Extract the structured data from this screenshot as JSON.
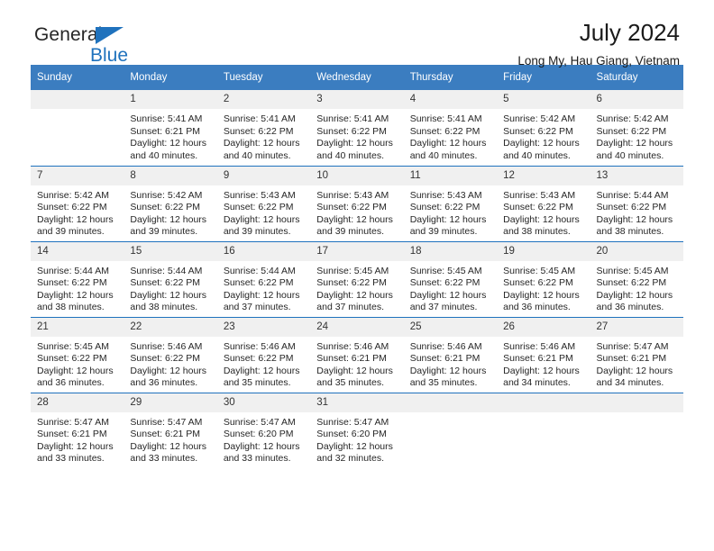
{
  "brand": {
    "name_part1": "General",
    "name_part2": "Blue",
    "flag_icon": "triangle-flag-icon"
  },
  "header": {
    "title": "July 2024",
    "subtitle": "Long My, Hau Giang, Vietnam"
  },
  "colors": {
    "header_blue": "#3b7dc0",
    "rule_blue": "#1f72bd",
    "daynum_band": "#f0f0f0",
    "brand_blue": "#1f72bd",
    "text": "#262626"
  },
  "weekday_headers": [
    "Sunday",
    "Monday",
    "Tuesday",
    "Wednesday",
    "Thursday",
    "Friday",
    "Saturday"
  ],
  "weeks": [
    {
      "days": [
        {
          "num": "",
          "blank": true,
          "lines": []
        },
        {
          "num": "1",
          "blank": false,
          "lines": [
            "Sunrise: 5:41 AM",
            "Sunset: 6:21 PM",
            "Daylight: 12 hours",
            "and 40 minutes."
          ]
        },
        {
          "num": "2",
          "blank": false,
          "lines": [
            "Sunrise: 5:41 AM",
            "Sunset: 6:22 PM",
            "Daylight: 12 hours",
            "and 40 minutes."
          ]
        },
        {
          "num": "3",
          "blank": false,
          "lines": [
            "Sunrise: 5:41 AM",
            "Sunset: 6:22 PM",
            "Daylight: 12 hours",
            "and 40 minutes."
          ]
        },
        {
          "num": "4",
          "blank": false,
          "lines": [
            "Sunrise: 5:41 AM",
            "Sunset: 6:22 PM",
            "Daylight: 12 hours",
            "and 40 minutes."
          ]
        },
        {
          "num": "5",
          "blank": false,
          "lines": [
            "Sunrise: 5:42 AM",
            "Sunset: 6:22 PM",
            "Daylight: 12 hours",
            "and 40 minutes."
          ]
        },
        {
          "num": "6",
          "blank": false,
          "lines": [
            "Sunrise: 5:42 AM",
            "Sunset: 6:22 PM",
            "Daylight: 12 hours",
            "and 40 minutes."
          ]
        }
      ]
    },
    {
      "days": [
        {
          "num": "7",
          "blank": false,
          "lines": [
            "Sunrise: 5:42 AM",
            "Sunset: 6:22 PM",
            "Daylight: 12 hours",
            "and 39 minutes."
          ]
        },
        {
          "num": "8",
          "blank": false,
          "lines": [
            "Sunrise: 5:42 AM",
            "Sunset: 6:22 PM",
            "Daylight: 12 hours",
            "and 39 minutes."
          ]
        },
        {
          "num": "9",
          "blank": false,
          "lines": [
            "Sunrise: 5:43 AM",
            "Sunset: 6:22 PM",
            "Daylight: 12 hours",
            "and 39 minutes."
          ]
        },
        {
          "num": "10",
          "blank": false,
          "lines": [
            "Sunrise: 5:43 AM",
            "Sunset: 6:22 PM",
            "Daylight: 12 hours",
            "and 39 minutes."
          ]
        },
        {
          "num": "11",
          "blank": false,
          "lines": [
            "Sunrise: 5:43 AM",
            "Sunset: 6:22 PM",
            "Daylight: 12 hours",
            "and 39 minutes."
          ]
        },
        {
          "num": "12",
          "blank": false,
          "lines": [
            "Sunrise: 5:43 AM",
            "Sunset: 6:22 PM",
            "Daylight: 12 hours",
            "and 38 minutes."
          ]
        },
        {
          "num": "13",
          "blank": false,
          "lines": [
            "Sunrise: 5:44 AM",
            "Sunset: 6:22 PM",
            "Daylight: 12 hours",
            "and 38 minutes."
          ]
        }
      ]
    },
    {
      "days": [
        {
          "num": "14",
          "blank": false,
          "lines": [
            "Sunrise: 5:44 AM",
            "Sunset: 6:22 PM",
            "Daylight: 12 hours",
            "and 38 minutes."
          ]
        },
        {
          "num": "15",
          "blank": false,
          "lines": [
            "Sunrise: 5:44 AM",
            "Sunset: 6:22 PM",
            "Daylight: 12 hours",
            "and 38 minutes."
          ]
        },
        {
          "num": "16",
          "blank": false,
          "lines": [
            "Sunrise: 5:44 AM",
            "Sunset: 6:22 PM",
            "Daylight: 12 hours",
            "and 37 minutes."
          ]
        },
        {
          "num": "17",
          "blank": false,
          "lines": [
            "Sunrise: 5:45 AM",
            "Sunset: 6:22 PM",
            "Daylight: 12 hours",
            "and 37 minutes."
          ]
        },
        {
          "num": "18",
          "blank": false,
          "lines": [
            "Sunrise: 5:45 AM",
            "Sunset: 6:22 PM",
            "Daylight: 12 hours",
            "and 37 minutes."
          ]
        },
        {
          "num": "19",
          "blank": false,
          "lines": [
            "Sunrise: 5:45 AM",
            "Sunset: 6:22 PM",
            "Daylight: 12 hours",
            "and 36 minutes."
          ]
        },
        {
          "num": "20",
          "blank": false,
          "lines": [
            "Sunrise: 5:45 AM",
            "Sunset: 6:22 PM",
            "Daylight: 12 hours",
            "and 36 minutes."
          ]
        }
      ]
    },
    {
      "days": [
        {
          "num": "21",
          "blank": false,
          "lines": [
            "Sunrise: 5:45 AM",
            "Sunset: 6:22 PM",
            "Daylight: 12 hours",
            "and 36 minutes."
          ]
        },
        {
          "num": "22",
          "blank": false,
          "lines": [
            "Sunrise: 5:46 AM",
            "Sunset: 6:22 PM",
            "Daylight: 12 hours",
            "and 36 minutes."
          ]
        },
        {
          "num": "23",
          "blank": false,
          "lines": [
            "Sunrise: 5:46 AM",
            "Sunset: 6:22 PM",
            "Daylight: 12 hours",
            "and 35 minutes."
          ]
        },
        {
          "num": "24",
          "blank": false,
          "lines": [
            "Sunrise: 5:46 AM",
            "Sunset: 6:21 PM",
            "Daylight: 12 hours",
            "and 35 minutes."
          ]
        },
        {
          "num": "25",
          "blank": false,
          "lines": [
            "Sunrise: 5:46 AM",
            "Sunset: 6:21 PM",
            "Daylight: 12 hours",
            "and 35 minutes."
          ]
        },
        {
          "num": "26",
          "blank": false,
          "lines": [
            "Sunrise: 5:46 AM",
            "Sunset: 6:21 PM",
            "Daylight: 12 hours",
            "and 34 minutes."
          ]
        },
        {
          "num": "27",
          "blank": false,
          "lines": [
            "Sunrise: 5:47 AM",
            "Sunset: 6:21 PM",
            "Daylight: 12 hours",
            "and 34 minutes."
          ]
        }
      ]
    },
    {
      "days": [
        {
          "num": "28",
          "blank": false,
          "lines": [
            "Sunrise: 5:47 AM",
            "Sunset: 6:21 PM",
            "Daylight: 12 hours",
            "and 33 minutes."
          ]
        },
        {
          "num": "29",
          "blank": false,
          "lines": [
            "Sunrise: 5:47 AM",
            "Sunset: 6:21 PM",
            "Daylight: 12 hours",
            "and 33 minutes."
          ]
        },
        {
          "num": "30",
          "blank": false,
          "lines": [
            "Sunrise: 5:47 AM",
            "Sunset: 6:20 PM",
            "Daylight: 12 hours",
            "and 33 minutes."
          ]
        },
        {
          "num": "31",
          "blank": false,
          "lines": [
            "Sunrise: 5:47 AM",
            "Sunset: 6:20 PM",
            "Daylight: 12 hours",
            "and 32 minutes."
          ]
        },
        {
          "num": "",
          "blank": true,
          "lines": []
        },
        {
          "num": "",
          "blank": true,
          "lines": []
        },
        {
          "num": "",
          "blank": true,
          "lines": []
        }
      ]
    }
  ]
}
